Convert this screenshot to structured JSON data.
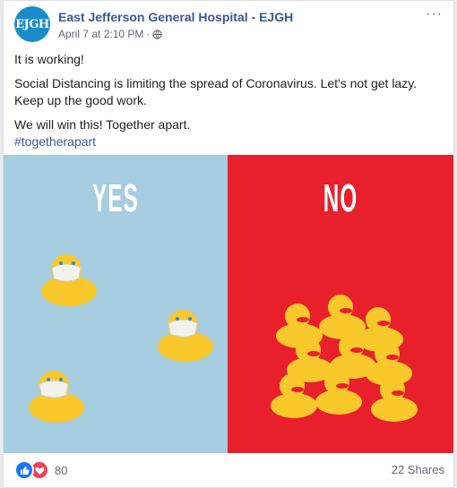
{
  "post": {
    "avatar_text": "EJGH",
    "page_name": "East Jefferson General Hospital - EJGH",
    "timestamp": "April 7 at 2:10 PM",
    "separator": "·",
    "privacy_icon": "globe-icon",
    "more_icon": "more-options-icon",
    "more_label": "···",
    "paragraphs": [
      "It is working!",
      "Social Distancing is limiting the spread of Coronavirus. Let's not get lazy. Keep up the good work.",
      "We will win this! Together apart."
    ],
    "hashtag": "#togetherapart"
  },
  "image": {
    "left_label": "YES",
    "right_label": "NO",
    "left_color": "#a7cde0",
    "right_color": "#e8202c"
  },
  "footer": {
    "reaction_icons": [
      "like-icon",
      "love-icon"
    ],
    "reaction_count": "80",
    "shares": "22 Shares"
  }
}
